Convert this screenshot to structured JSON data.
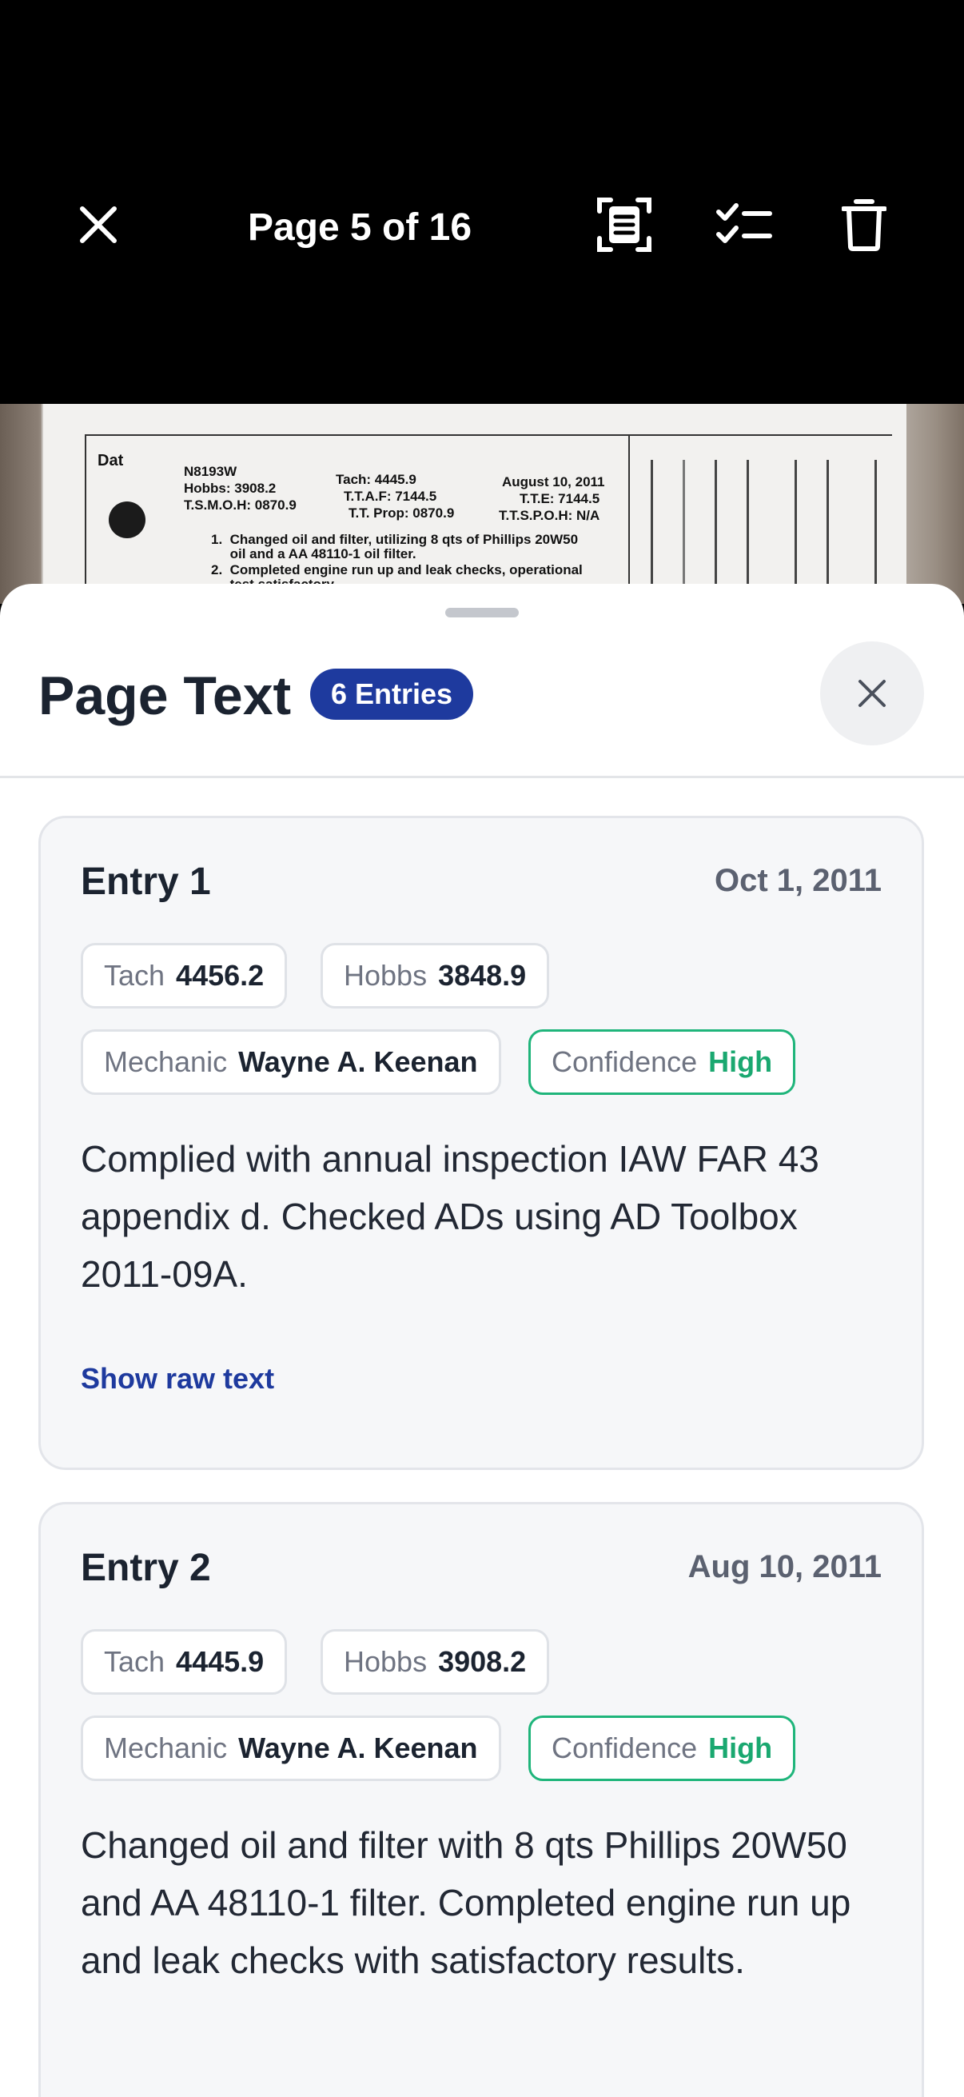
{
  "toolbar": {
    "page_indicator": "Page 5 of 16"
  },
  "document_photo": {
    "lines": [
      "Dat",
      "N8193W",
      "Hobbs: 3908.2",
      "T.S.M.O.H: 0870.9",
      "Tach: 4445.9",
      "T.T.A.F: 7144.5",
      "T.T. Prop: 0870.9",
      "August 10, 2011",
      "T.T.E: 7144.5",
      "T.T.S.P.O.H: N/A",
      "1.  Changed oil and filter, utilizing 8 qts of Phillips 20W50",
      "     oil and a AA 48110-1 oil filter.",
      "2.  Completed engine run up and leak checks, operational",
      "     test satisfactory..."
    ]
  },
  "sheet": {
    "title": "Page Text",
    "badge": "6 Entries"
  },
  "entries": [
    {
      "title": "Entry 1",
      "date": "Oct 1, 2011",
      "tach_label": "Tach",
      "tach": "4456.2",
      "hobbs_label": "Hobbs",
      "hobbs": "3848.9",
      "mechanic_label": "Mechanic",
      "mechanic": "Wayne A. Keenan",
      "confidence_label": "Confidence",
      "confidence": "High",
      "text": "Complied with annual inspection IAW FAR 43 appendix d. Checked ADs using AD Toolbox 2011-09A.",
      "raw_link": "Show raw text"
    },
    {
      "title": "Entry 2",
      "date": "Aug 10, 2011",
      "tach_label": "Tach",
      "tach": "4445.9",
      "hobbs_label": "Hobbs",
      "hobbs": "3908.2",
      "mechanic_label": "Mechanic",
      "mechanic": "Wayne A. Keenan",
      "confidence_label": "Confidence",
      "confidence": "High",
      "text": "Changed oil and filter with 8 qts Phillips 20W50 and AA 48110-1 filter. Completed engine run up and leak checks with satisfactory results."
    }
  ]
}
